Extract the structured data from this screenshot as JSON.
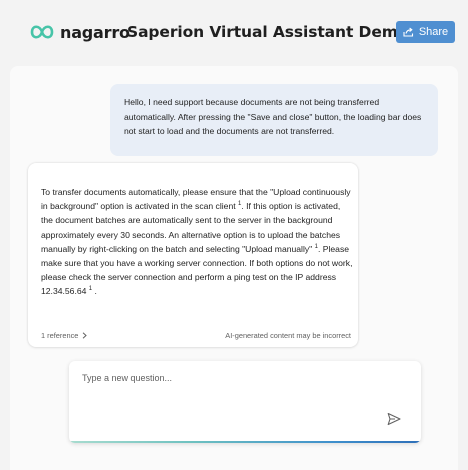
{
  "header": {
    "logo_text": "nagarro",
    "title": "Saperion Virtual Assistant Demo",
    "share_label": "Share",
    "share_icon": "share-icon",
    "accent_color": "#4f8fd1"
  },
  "conversation": {
    "user_message": "Hello, I need support because documents are not being transferred automatically. After pressing the \"Save and close\" button, the loading bar does not start to load and the documents are not transferred.",
    "bot_message": {
      "part1": "To transfer documents automatically, please ensure that the \"Upload continuously in background\" option is activated in the scan client",
      "ref1": "1",
      "part2": ". If this option is activated, the document batches are automatically sent to the server in the background approximately every 30 seconds. An alternative option is to upload the batches manually by right-clicking on the batch and selecting \"Upload manually\"",
      "ref2": "1",
      "part3": ". Please make sure that you have a working server connection. If both options do not work, please check the server connection and perform a ping test on the IP address 12.34.56.64",
      "ref3": "1",
      "part4": " ."
    },
    "references_label": "1 reference",
    "disclaimer": "AI-generated content may be incorrect"
  },
  "input": {
    "placeholder": "Type a new question...",
    "value": "",
    "send_icon": "send-icon"
  }
}
